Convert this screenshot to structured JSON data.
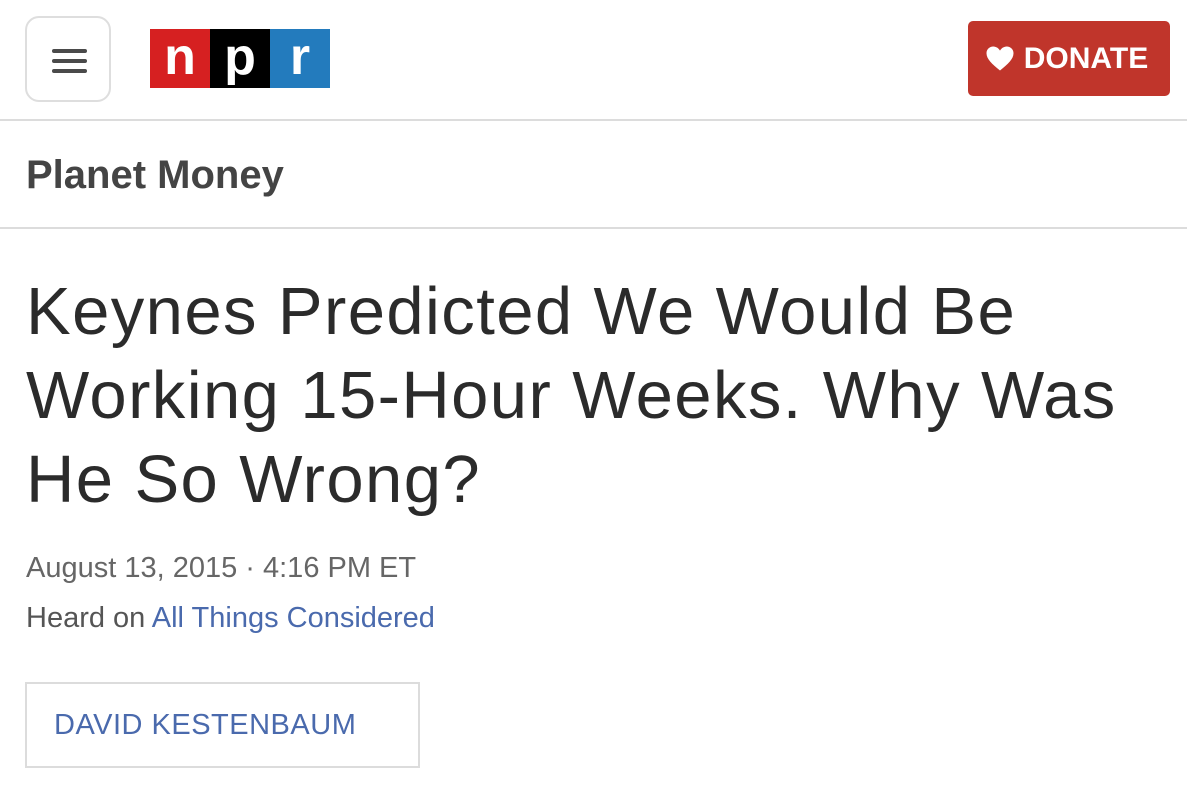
{
  "colors": {
    "npr_red": "#d62021",
    "npr_black": "#000000",
    "npr_blue": "#237bbd",
    "donate_red": "#c0352b",
    "link_blue": "#4a6aad"
  },
  "header": {
    "menu_icon": "hamburger-menu-icon",
    "logo": {
      "letters": [
        "n",
        "p",
        "r"
      ]
    },
    "donate": {
      "icon": "heart-icon",
      "label": "DONATE"
    }
  },
  "section": {
    "title": "Planet Money"
  },
  "article": {
    "headline": "Keynes Predicted We Would Be Working 15-Hour Weeks. Why Was He So Wrong?",
    "date": "August 13, 2015 · 4:16 PM ET",
    "heard_on_prefix": "Heard on ",
    "heard_on_show": "All Things Considered",
    "author": "DAVID KESTENBAUM"
  }
}
